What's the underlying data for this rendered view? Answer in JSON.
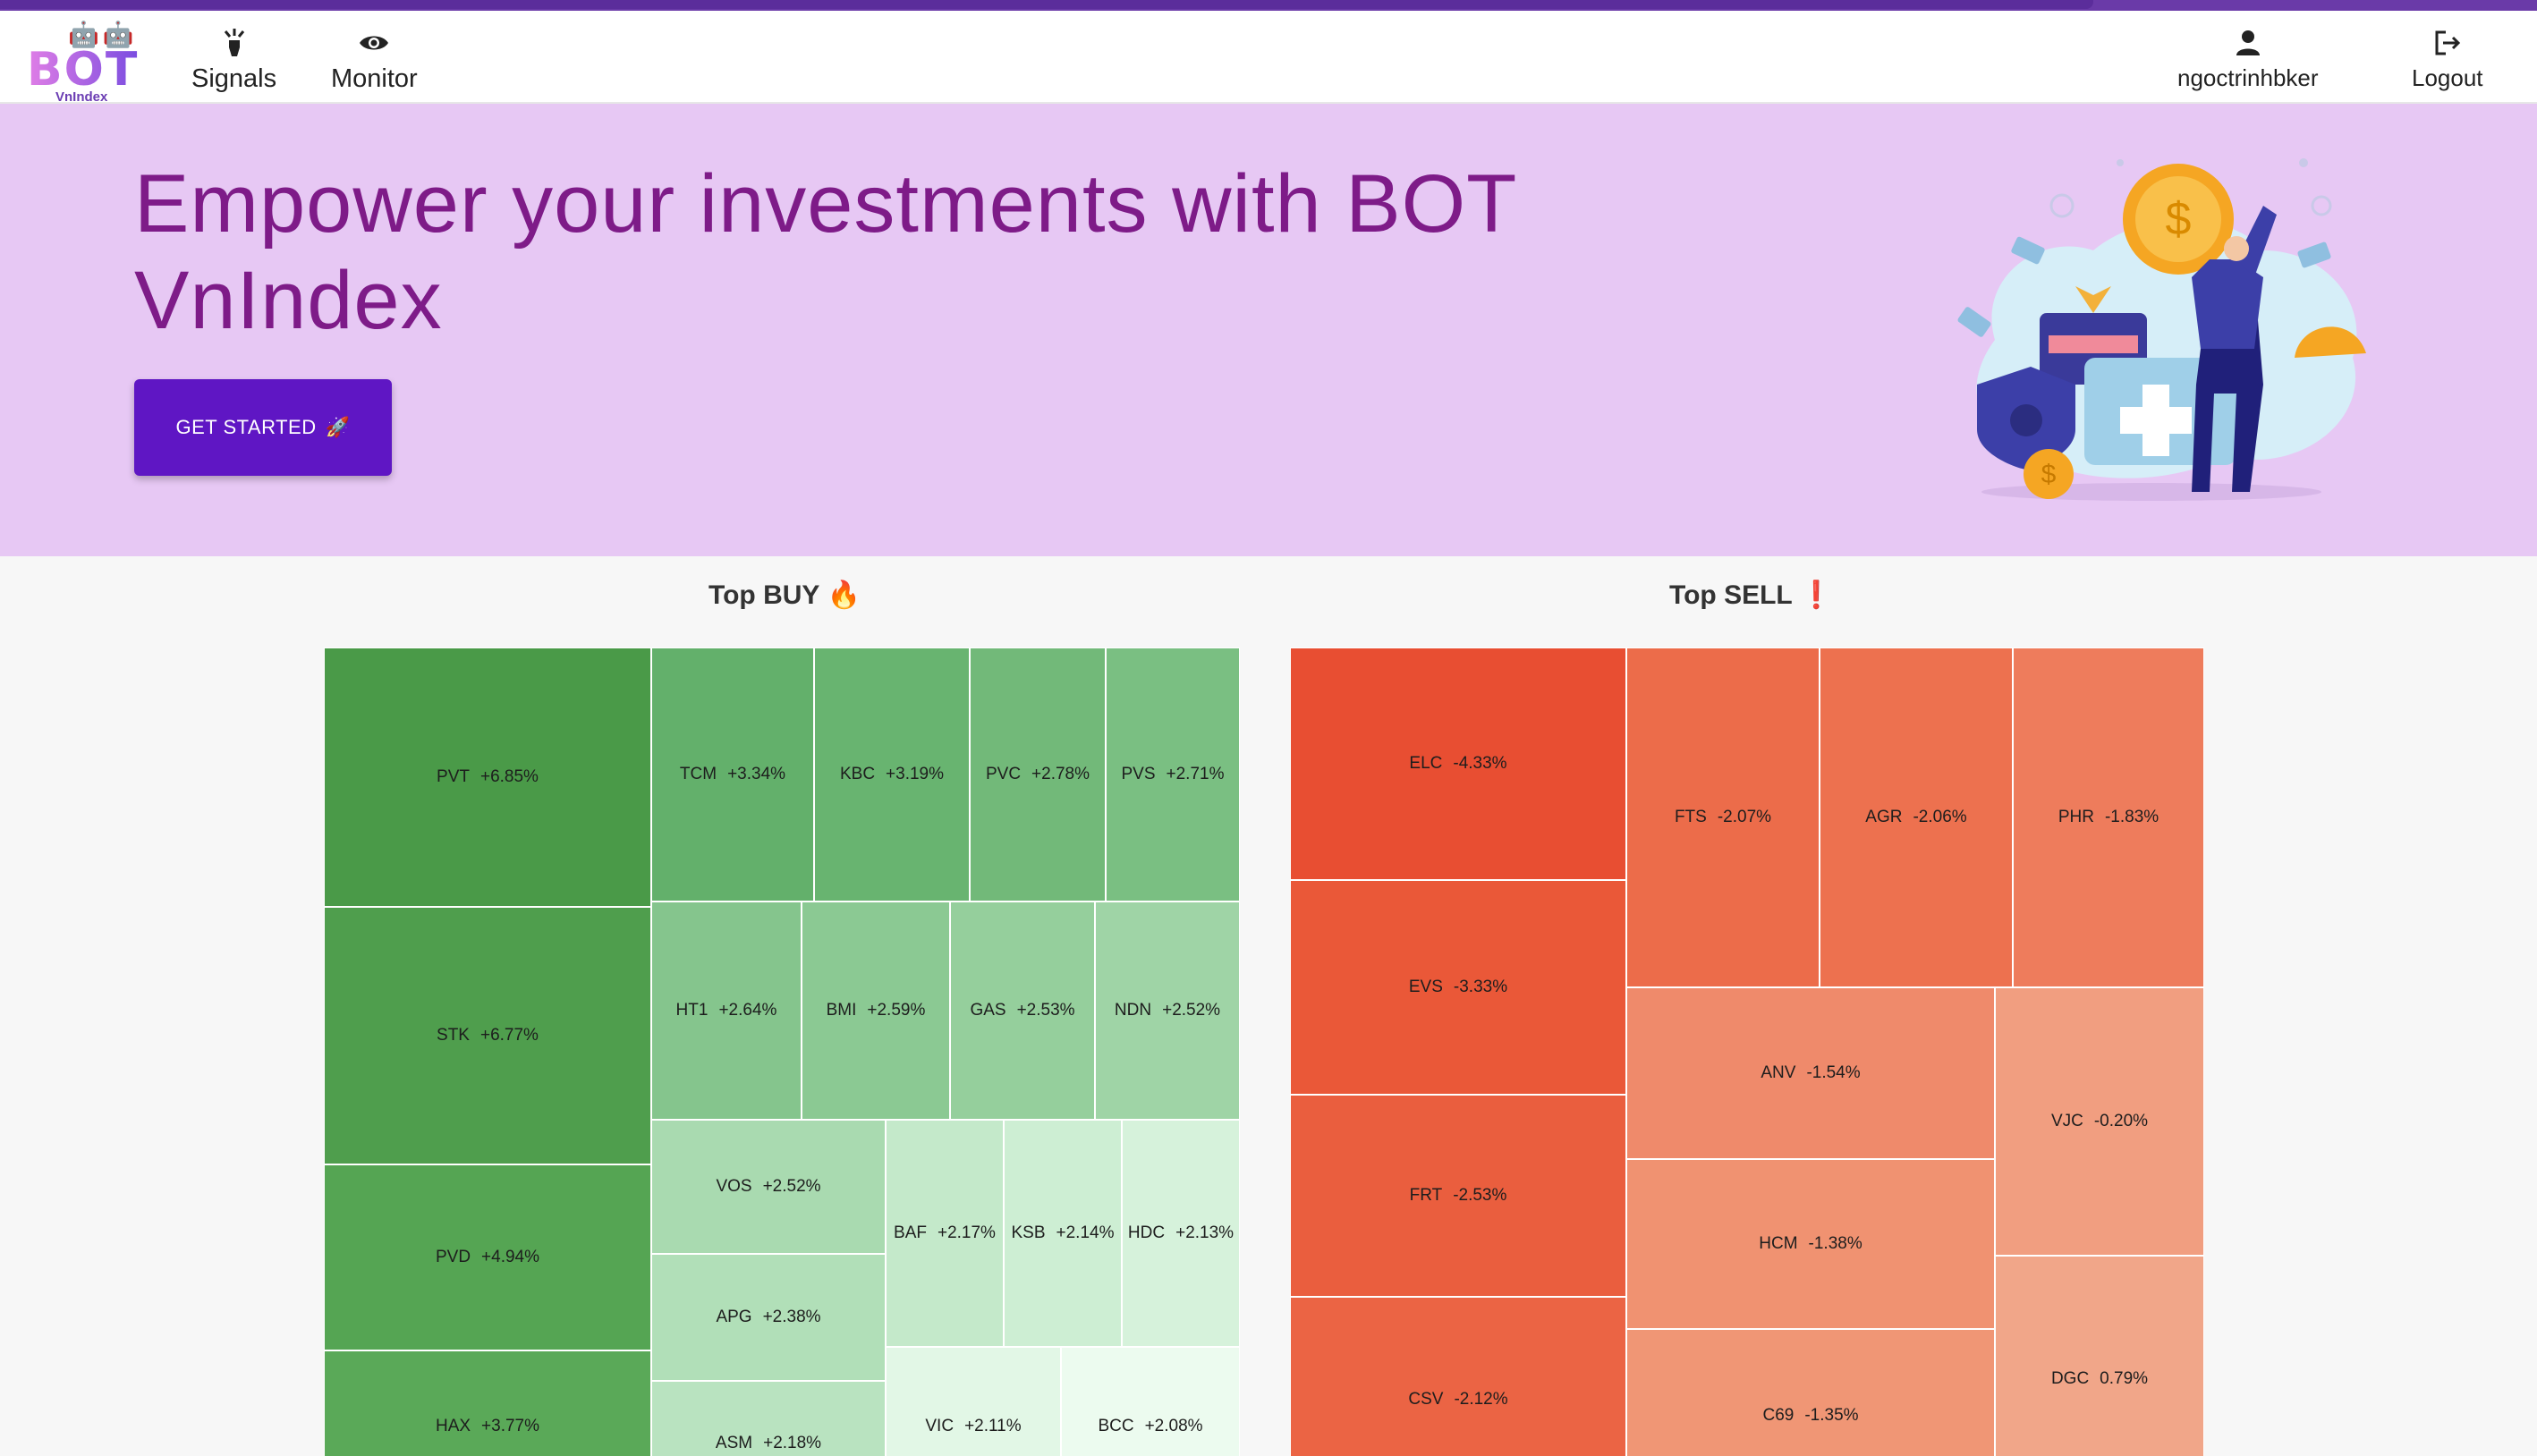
{
  "brand": {
    "name": "BOT",
    "sub": "VnIndex",
    "robots": "🤖🤖"
  },
  "nav": {
    "signals_label": "Signals",
    "monitor_label": "Monitor",
    "user_label": "ngoctrinhbker",
    "logout_label": "Logout"
  },
  "hero": {
    "title": "Empower your investments with BOT VnIndex",
    "cta_label": "GET STARTED",
    "cta_emoji": "🚀"
  },
  "top_buy": {
    "title": "Top BUY",
    "emoji": "🔥",
    "items": [
      {
        "code": "PVT",
        "change": "+6.85%",
        "color": "#4a9a48"
      },
      {
        "code": "STK",
        "change": "+6.77%",
        "color": "#4f9e4d"
      },
      {
        "code": "PVD",
        "change": "+4.94%",
        "color": "#55a553"
      },
      {
        "code": "HAX",
        "change": "+3.77%",
        "color": "#5aa958"
      },
      {
        "code": "TCM",
        "change": "+3.34%",
        "color": "#63b06b"
      },
      {
        "code": "KBC",
        "change": "+3.19%",
        "color": "#68b470"
      },
      {
        "code": "PVC",
        "change": "+2.78%",
        "color": "#72b979"
      },
      {
        "code": "PVS",
        "change": "+2.71%",
        "color": "#7abf82"
      },
      {
        "code": "HT1",
        "change": "+2.64%",
        "color": "#85c58d"
      },
      {
        "code": "BMI",
        "change": "+2.59%",
        "color": "#8bc993"
      },
      {
        "code": "GAS",
        "change": "+2.53%",
        "color": "#95cf9c"
      },
      {
        "code": "NDN",
        "change": "+2.52%",
        "color": "#9fd4a6"
      },
      {
        "code": "VOS",
        "change": "+2.52%",
        "color": "#a9dab0"
      },
      {
        "code": "APG",
        "change": "+2.38%",
        "color": "#b1dfb8"
      },
      {
        "code": "ASM",
        "change": "+2.18%",
        "color": "#b9e3c0"
      },
      {
        "code": "BAF",
        "change": "+2.17%",
        "color": "#c4e9ca"
      },
      {
        "code": "KSB",
        "change": "+2.14%",
        "color": "#cdeed3"
      },
      {
        "code": "HDC",
        "change": "+2.13%",
        "color": "#d6f2db"
      },
      {
        "code": "VIC",
        "change": "+2.11%",
        "color": "#e2f7e6"
      },
      {
        "code": "BCC",
        "change": "+2.08%",
        "color": "#ecfbef"
      }
    ]
  },
  "top_sell": {
    "title": "Top SELL",
    "emoji": "❗",
    "items": [
      {
        "code": "ELC",
        "change": "-4.33%",
        "color": "#e84e32"
      },
      {
        "code": "EVS",
        "change": "-3.33%",
        "color": "#ea5838"
      },
      {
        "code": "FRT",
        "change": "-2.53%",
        "color": "#ea5e3e"
      },
      {
        "code": "CSV",
        "change": "-2.12%",
        "color": "#eb6444"
      },
      {
        "code": "FTS",
        "change": "-2.07%",
        "color": "#ec6c4a"
      },
      {
        "code": "AGR",
        "change": "-2.06%",
        "color": "#ed714f"
      },
      {
        "code": "PHR",
        "change": "-1.83%",
        "color": "#ee7c5c"
      },
      {
        "code": "ANV",
        "change": "-1.54%",
        "color": "#ef8a6b"
      },
      {
        "code": "HCM",
        "change": "-1.38%",
        "color": "#f09271"
      },
      {
        "code": "C69",
        "change": "-1.35%",
        "color": "#f09675"
      },
      {
        "code": "VJC",
        "change": "-0.20%",
        "color": "#f19e80"
      },
      {
        "code": "DGC",
        "change": "0.79%",
        "color": "#f1a689"
      }
    ]
  }
}
